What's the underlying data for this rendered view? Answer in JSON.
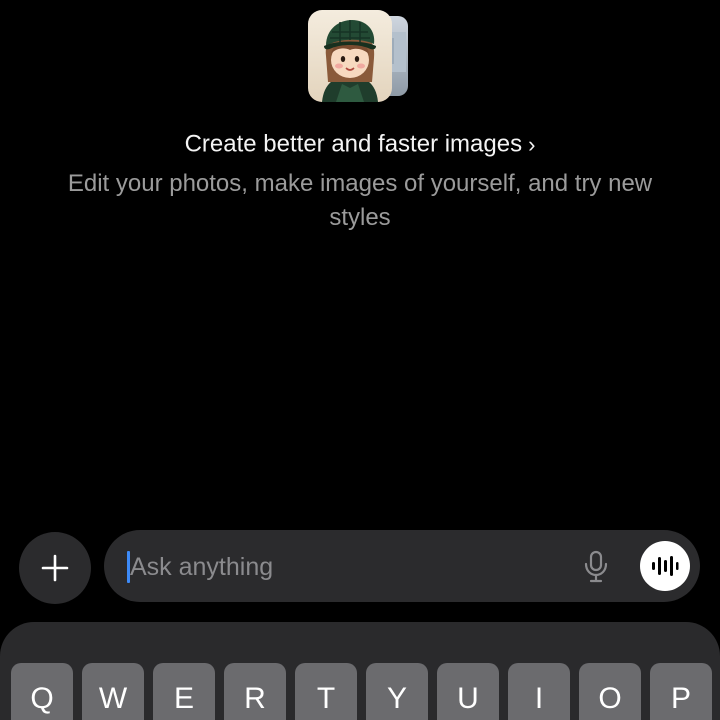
{
  "promo": {
    "thumbnail_icon": "cartoon-girl-avatar",
    "title": "Create better and faster images",
    "chevron": "›",
    "subtitle": "Edit your photos, make images of yourself, and try new styles"
  },
  "composer": {
    "add_icon": "plus-icon",
    "placeholder": "Ask anything",
    "mic_icon": "microphone-icon",
    "voice_icon": "voice-waveform-icon"
  },
  "keyboard": {
    "row1": [
      "Q",
      "W",
      "E",
      "R",
      "T",
      "Y",
      "U",
      "I",
      "O",
      "P"
    ]
  },
  "colors": {
    "background": "#000000",
    "surface": "#2b2b2d",
    "caret": "#3d8af7",
    "key": "#6b6b6e"
  }
}
